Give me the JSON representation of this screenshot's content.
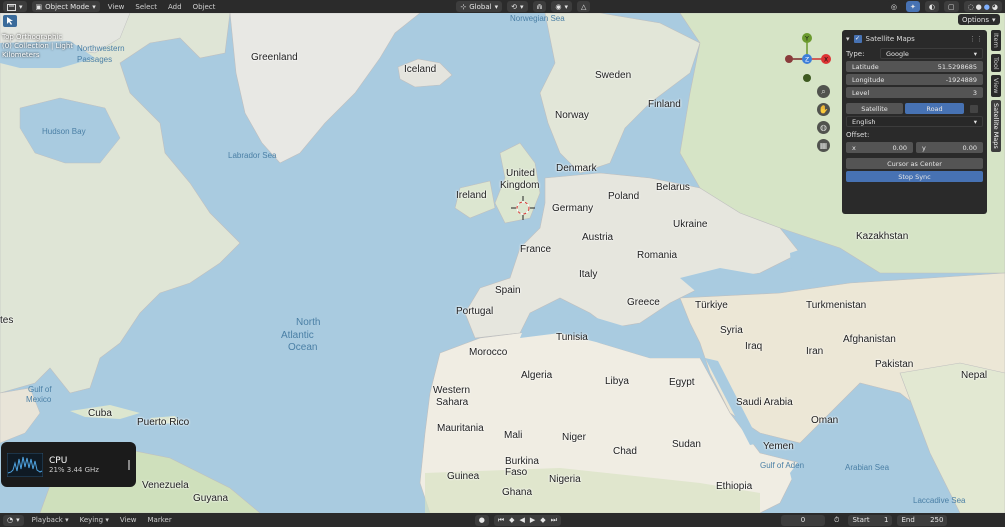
{
  "header": {
    "mode": "Object Mode",
    "menus": [
      "View",
      "Select",
      "Add",
      "Object"
    ],
    "transform_orientation": "Global",
    "options": "Options"
  },
  "viewport_overlay": {
    "view_name": "Top Orthographic",
    "collection": "(0) Collection | Light",
    "units": "Kilometers"
  },
  "map_labels": {
    "countries": [
      "Greenland",
      "Iceland",
      "Sweden",
      "Finland",
      "Norway",
      "Denmark",
      "United",
      "Kingdom",
      "Ireland",
      "Germany",
      "Poland",
      "Belarus",
      "Ukraine",
      "Austria",
      "France",
      "Romania",
      "Italy",
      "Spain",
      "Portugal",
      "Greece",
      "Türkiye",
      "Syria",
      "Iraq",
      "Iran",
      "Turkmenistan",
      "Afghanistan",
      "Kazakhstan",
      "Pakistan",
      "Nepal",
      "Tunisia",
      "Morocco",
      "Algeria",
      "Libya",
      "Egypt",
      "Saudi Arabia",
      "Western",
      "Sahara",
      "Mauritania",
      "Mali",
      "Niger",
      "Chad",
      "Sudan",
      "Yemen",
      "Oman",
      "Burkina",
      "Faso",
      "Nigeria",
      "Guinea",
      "Ghana",
      "Ethiopia",
      "Cuba",
      "Puerto Rico",
      "Venezuela",
      "Guyana",
      "Mexico",
      "tes"
    ],
    "seas": [
      "Northwestern",
      "Passages",
      "Hudson Bay",
      "Labrador Sea",
      "North",
      "Atlantic",
      "Ocean",
      "Gulf of",
      "Mexico",
      "Norwegian Sea",
      "Gulf of Aden",
      "Arabian Sea",
      "Laccadive Sea"
    ]
  },
  "panel": {
    "title": "Satellite Maps",
    "type_label": "Type:",
    "type_value": "Google",
    "latitude_label": "Latitude",
    "latitude_value": "51.5298685",
    "longitude_label": "Longitude",
    "longitude_value": "-1924889",
    "level_label": "Level",
    "level_value": "3",
    "tab_satellite": "Satellite",
    "tab_road": "Road",
    "language": "English",
    "offset_label": "Offset:",
    "offset_x_label": "x",
    "offset_x_value": "0.00",
    "offset_y_label": "y",
    "offset_y_value": "0.00",
    "cursor_button": "Cursor as Center",
    "sync_button": "Stop Sync"
  },
  "side_tabs": [
    "Item",
    "Tool",
    "View",
    "Satellite Maps"
  ],
  "gizmo": {
    "y": "Y",
    "z": "Z",
    "x": "X"
  },
  "cpu_widget": {
    "title": "CPU",
    "stats": "21% 3.44 GHz"
  },
  "timeline": {
    "menus": [
      "Playback",
      "Keying",
      "View",
      "Marker"
    ],
    "current_frame": "0",
    "start_label": "Start",
    "start_value": "1",
    "end_label": "End",
    "end_value": "250"
  },
  "colors": {
    "accent": "#4772b3",
    "ocean": "#a9cbe0",
    "land": "#e6e6de",
    "green": "#c4dcb4",
    "desert": "#f0ede3"
  }
}
